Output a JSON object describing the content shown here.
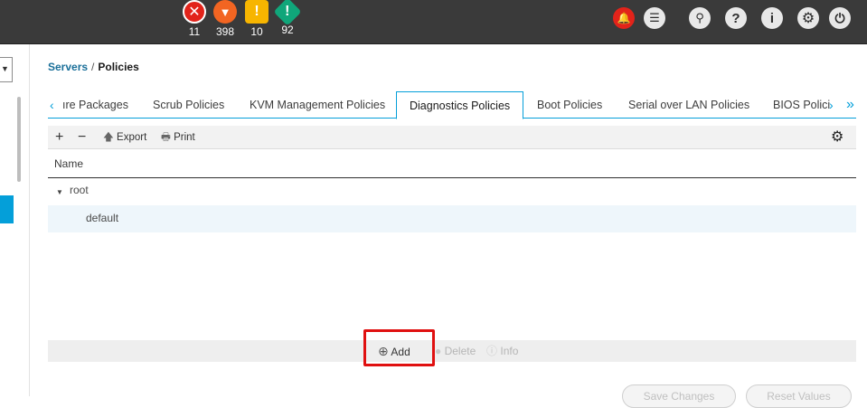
{
  "faults": [
    {
      "name": "critical",
      "count": "11",
      "color": "#e2231a",
      "glyph": "✕"
    },
    {
      "name": "major",
      "count": "398",
      "color": "#f26522",
      "glyph": "▼"
    },
    {
      "name": "minor",
      "count": "10",
      "color": "#f7b500",
      "glyph": "!"
    },
    {
      "name": "warning",
      "count": "92",
      "color": "#10a67a",
      "glyph": "!"
    }
  ],
  "topicons": {
    "alert": "alarm-bell-icon",
    "list": "task-list-icon",
    "search": "search-icon",
    "help": "?",
    "info": "i",
    "settings": "gear-icon",
    "logout": "logout-icon"
  },
  "breadcrumb": {
    "root": "Servers",
    "sep": "/",
    "current": "Policies"
  },
  "tabs": [
    "ıre Packages",
    "Scrub Policies",
    "KVM Management Policies",
    "Diagnostics Policies",
    "Boot Policies",
    "Serial over LAN Policies",
    "BIOS Polici"
  ],
  "toolbar": {
    "add": "+",
    "remove": "−",
    "export": "Export",
    "print": "Print"
  },
  "table": {
    "column": "Name",
    "rows": [
      {
        "label": "root",
        "expanded": true
      },
      {
        "label": "default"
      }
    ]
  },
  "footer": {
    "add": "Add",
    "delete": "Delete",
    "info": "Info"
  },
  "buttons": {
    "save": "Save Changes",
    "reset": "Reset Values"
  }
}
